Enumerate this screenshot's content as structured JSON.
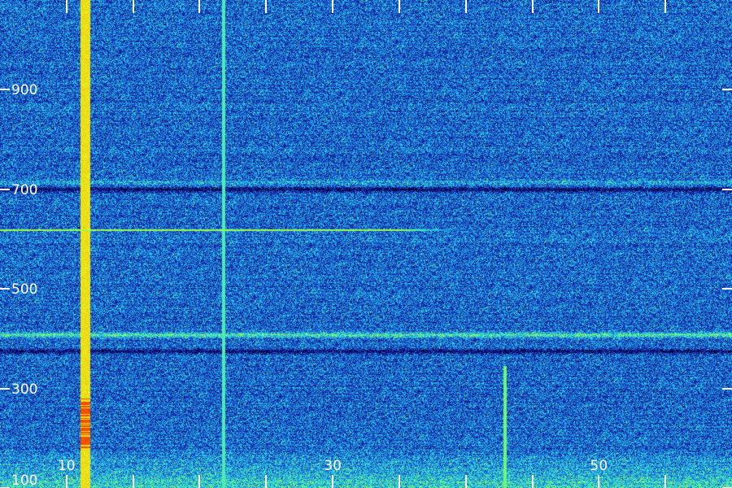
{
  "chart_data": {
    "type": "heatmap",
    "title": "",
    "xlabel": "",
    "ylabel": "",
    "xlim": [
      5,
      60
    ],
    "ylim": [
      100,
      1080
    ],
    "x_ticks": [
      10,
      30,
      50
    ],
    "x_tick_labels": [
      "10",
      "30",
      "50"
    ],
    "x_minor_ticks": [
      5,
      10,
      15,
      20,
      25,
      30,
      35,
      40,
      45,
      50,
      55,
      60
    ],
    "y_ticks": [
      100,
      300,
      500,
      700,
      900
    ],
    "y_tick_labels": [
      "100",
      "300",
      "500",
      "700",
      "900"
    ],
    "colormap": [
      "#000010",
      "#0a0a6e",
      "#1d2fb8",
      "#1a8ce0",
      "#2ee0e8",
      "#7cff5a",
      "#e6ff1e",
      "#ff7a00",
      "#e00000"
    ],
    "background_level": 0.32,
    "grid": false,
    "features": [
      {
        "kind": "vertical_line",
        "x": 11.4,
        "width": 0.6,
        "level": 0.78,
        "hot_range": [
          180,
          280
        ],
        "hot_level": 0.92
      },
      {
        "kind": "vertical_line",
        "x": 21.8,
        "width": 0.12,
        "level": 0.55
      },
      {
        "kind": "vertical_line",
        "x": 42.9,
        "width": 0.12,
        "level": 0.6,
        "y_range": [
          100,
          345
        ]
      },
      {
        "kind": "horizontal_line",
        "y": 620,
        "x_range": [
          5,
          35
        ],
        "level": 0.7,
        "fade_to": 40
      },
      {
        "kind": "horizontal_band",
        "y": 408,
        "level": 0.55
      },
      {
        "kind": "horizontal_band",
        "y": 714,
        "level": 0.42
      },
      {
        "kind": "dark_band",
        "y": 700,
        "level": 0.12
      },
      {
        "kind": "dark_band",
        "y": 375,
        "level": 0.14
      },
      {
        "kind": "bright_floor",
        "y_range": [
          100,
          180
        ],
        "level": 0.5
      }
    ]
  }
}
